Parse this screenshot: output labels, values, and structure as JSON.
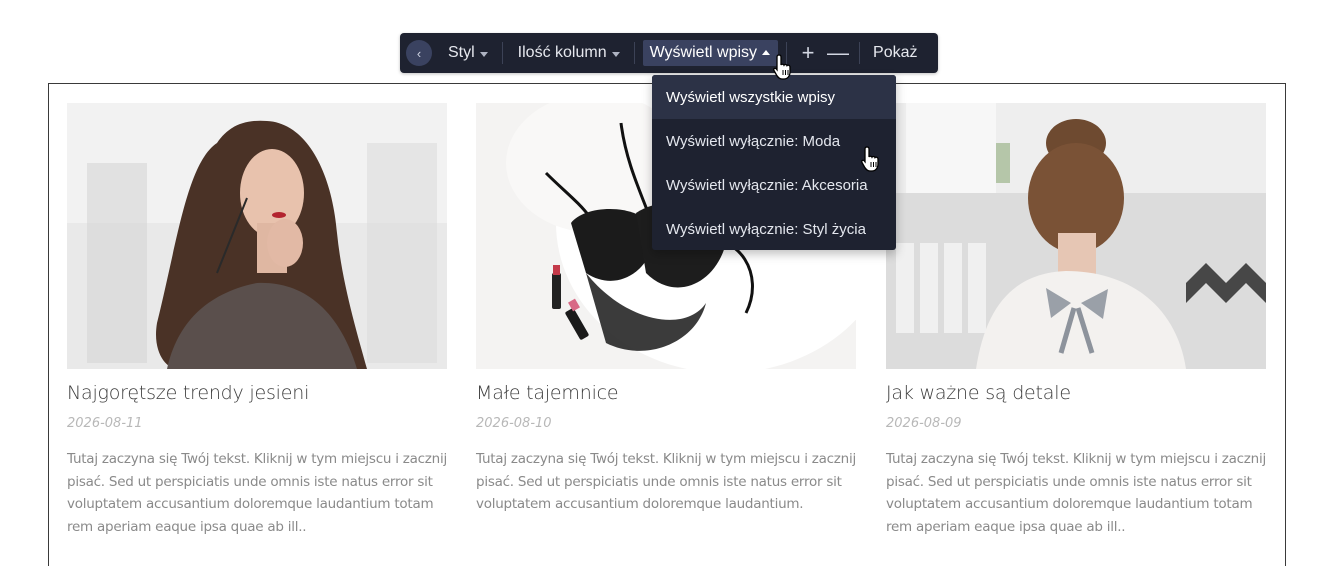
{
  "toolbar": {
    "back_icon": "chevron-left-icon",
    "style_label": "Styl",
    "columns_label": "Ilość kolumn",
    "show_posts_label": "Wyświetl wpisy",
    "plus_label": "+",
    "minus_label": "—",
    "pokaz_label": "Pokaż"
  },
  "dropdown": {
    "items": [
      {
        "label": "Wyświetl wszystkie wpisy",
        "active": true
      },
      {
        "label": "Wyświetl wyłącznie: Moda",
        "active": false
      },
      {
        "label": "Wyświetl wyłącznie: Akcesoria",
        "active": false
      },
      {
        "label": "Wyświetl wyłącznie: Styl życia",
        "active": false
      }
    ]
  },
  "posts": [
    {
      "title": "Najgorętsze trendy jesieni",
      "date": "2026-08-11",
      "excerpt": "Tutaj zaczyna się Twój tekst. Kliknij w tym miejscu i zacznij pisać. Sed ut perspiciatis unde omnis iste natus error sit voluptatem accusantium doloremque laudantium totam rem aperiam eaque ipsa quae ab ill..",
      "image": "woman-with-sunglasses-photo"
    },
    {
      "title": "Małe tajemnice",
      "date": "2026-08-10",
      "excerpt": "Tutaj zaczyna się Twój tekst. Kliknij w tym miejscu i zacznij pisać. Sed ut perspiciatis unde omnis iste natus error sit voluptatem accusantium doloremque laudantium.",
      "image": "lace-lingerie-on-fur-photo"
    },
    {
      "title": "Jak ważne są detale",
      "date": "2026-08-09",
      "excerpt": "Tutaj zaczyna się Twój tekst. Kliknij w tym miejscu i zacznij pisać. Sed ut perspiciatis unde omnis iste natus error sit voluptatem accusantium doloremque laudantium totam rem aperiam eaque ipsa quae ab ill..",
      "image": "woman-back-bow-photo"
    }
  ],
  "colors": {
    "toolbar_bg": "#1e2230",
    "toolbar_active": "#3a4260",
    "dropdown_active": "#2c3246",
    "title_text": "#3d3d3d",
    "date_text": "#b8b8b8",
    "excerpt_text": "#8a8a8a"
  }
}
